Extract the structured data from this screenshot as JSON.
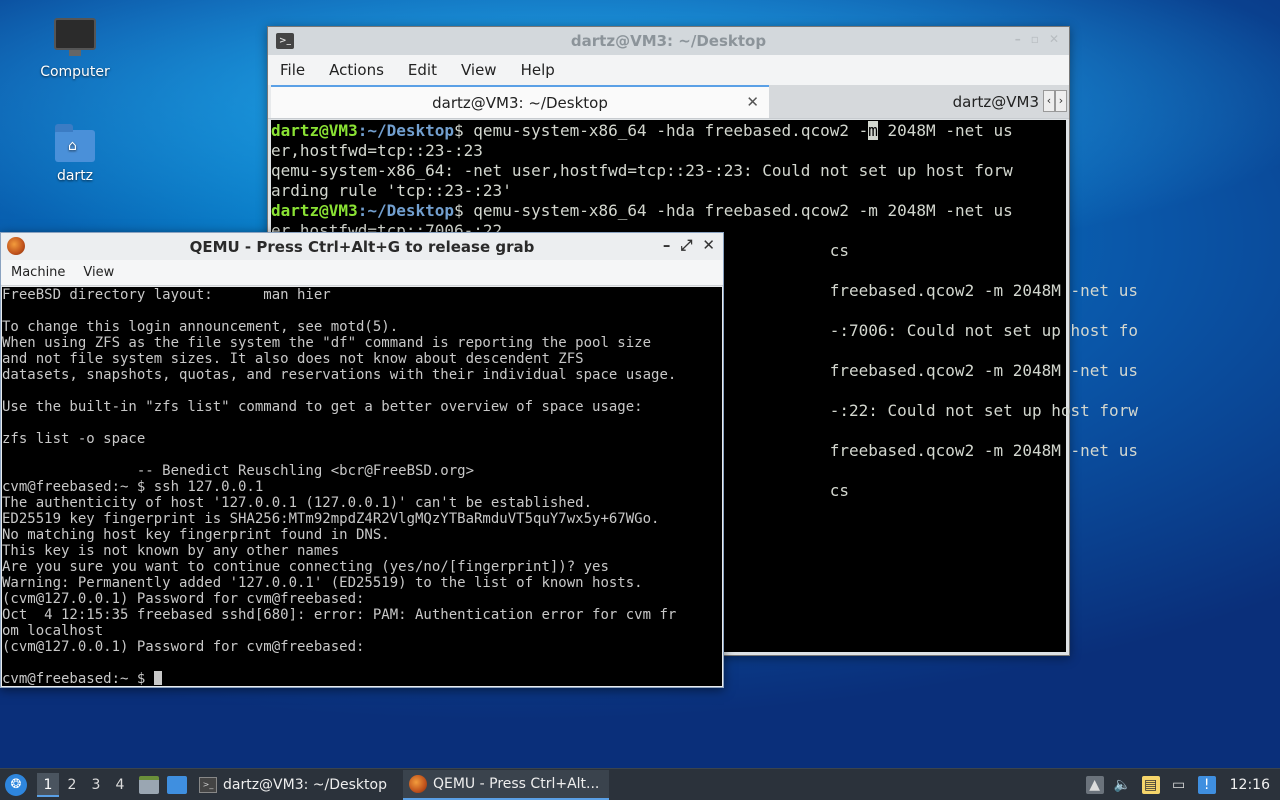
{
  "desktop": {
    "icons": [
      {
        "label": "Computer"
      },
      {
        "label": "dartz"
      }
    ]
  },
  "terminal": {
    "title": "dartz@VM3: ~/Desktop",
    "menu": [
      "File",
      "Actions",
      "Edit",
      "View",
      "Help"
    ],
    "tabs": [
      {
        "label": "dartz@VM3: ~/Desktop",
        "active": true
      },
      {
        "label": "dartz@VM3",
        "active": false
      }
    ],
    "prompt_user": "dartz@VM3",
    "prompt_path": ":~/Desktop",
    "lines": [
      {
        "type": "prompt",
        "text": "$ qemu-system-x86_64 -hda freebased.qcow2 -",
        "cursor": "m",
        "after": " 2048M -net us"
      },
      {
        "type": "out",
        "text": "er,hostfwd=tcp::23-:23"
      },
      {
        "type": "out",
        "text": "qemu-system-x86_64: -net user,hostfwd=tcp::23-:23: Could not set up host forw"
      },
      {
        "type": "out",
        "text": "arding rule 'tcp::23-:23'"
      },
      {
        "type": "prompt",
        "text": "$ qemu-system-x86_64 -hda freebased.qcow2 -m 2048M -net us"
      },
      {
        "type": "out",
        "text": "er,hostfwd=tcp::7006-:22"
      },
      {
        "type": "out",
        "text": "                                                          cs"
      },
      {
        "type": "out",
        "text": ""
      },
      {
        "type": "out",
        "text": "                                                          freebased.qcow2 -m 2048M -net us"
      },
      {
        "type": "out",
        "text": ""
      },
      {
        "type": "out",
        "text": "                                                          -:7006: Could not set up host fo"
      },
      {
        "type": "out",
        "text": ""
      },
      {
        "type": "out",
        "text": "                                                          freebased.qcow2 -m 2048M -net us"
      },
      {
        "type": "out",
        "text": ""
      },
      {
        "type": "out",
        "text": "                                                          -:22: Could not set up host forw"
      },
      {
        "type": "out",
        "text": ""
      },
      {
        "type": "out",
        "text": "                                                          freebased.qcow2 -m 2048M -net us"
      },
      {
        "type": "out",
        "text": ""
      },
      {
        "type": "out",
        "text": "                                                          cs"
      }
    ]
  },
  "qemu": {
    "title": "QEMU - Press Ctrl+Alt+G to release grab",
    "menu": [
      "Machine",
      "View"
    ],
    "lines": [
      "FreeBSD directory layout:      man hier",
      "",
      "To change this login announcement, see motd(5).",
      "When using ZFS as the file system the \"df\" command is reporting the pool size",
      "and not file system sizes. It also does not know about descendent ZFS",
      "datasets, snapshots, quotas, and reservations with their individual space usage.",
      "",
      "Use the built-in \"zfs list\" command to get a better overview of space usage:",
      "",
      "zfs list -o space",
      "",
      "                -- Benedict Reuschling <bcr@FreeBSD.org>",
      "cvm@freebased:~ $ ssh 127.0.0.1",
      "The authenticity of host '127.0.0.1 (127.0.0.1)' can't be established.",
      "ED25519 key fingerprint is SHA256:MTm92mpdZ4R2VlgMQzYTBaRmduVT5quY7wx5y+67WGo.",
      "No matching host key fingerprint found in DNS.",
      "This key is not known by any other names",
      "Are you sure you want to continue connecting (yes/no/[fingerprint])? yes",
      "Warning: Permanently added '127.0.0.1' (ED25519) to the list of known hosts.",
      "(cvm@127.0.0.1) Password for cvm@freebased:",
      "Oct  4 12:15:35 freebased sshd[680]: error: PAM: Authentication error for cvm fr",
      "om localhost",
      "(cvm@127.0.0.1) Password for cvm@freebased:",
      "",
      "cvm@freebased:~ $ "
    ]
  },
  "taskbar": {
    "workspaces": [
      "1",
      "2",
      "3",
      "4"
    ],
    "active_workspace": "1",
    "tasks": [
      {
        "label": "dartz@VM3: ~/Desktop",
        "icon": "terminal-icon",
        "active": false
      },
      {
        "label": "QEMU - Press Ctrl+Alt...",
        "icon": "qemu-icon",
        "active": true
      }
    ],
    "clock": "12:16"
  }
}
